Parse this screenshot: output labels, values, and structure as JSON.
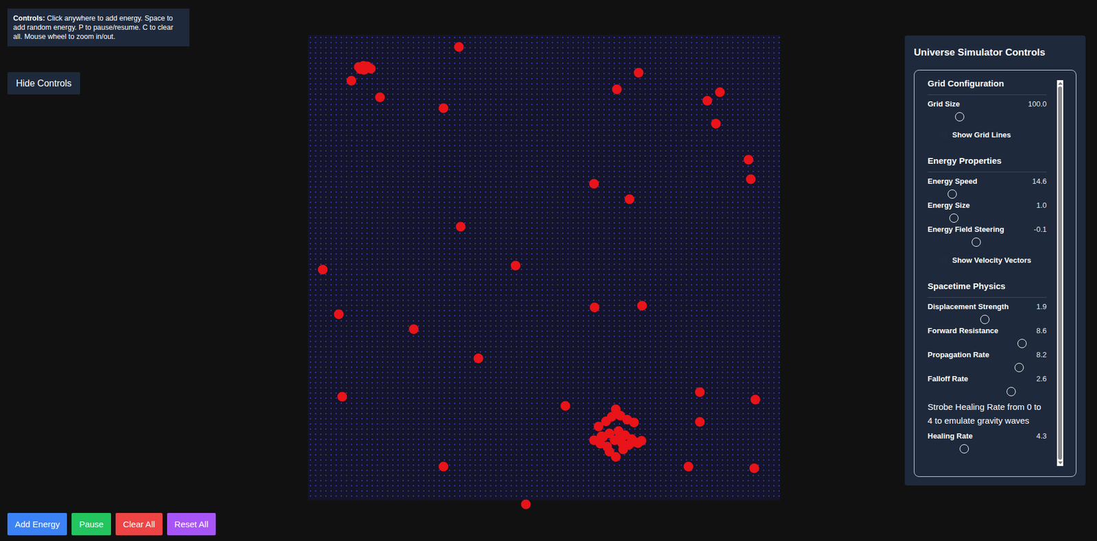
{
  "help": {
    "label": "Controls:",
    "text": " Click anywhere to add energy. Space to add random energy. P to pause/resume. C to clear all. Mouse wheel to zoom in/out."
  },
  "toggle_button": "Hide Controls",
  "panel": {
    "title": "Universe Simulator Controls",
    "sections": [
      {
        "title": "Grid Configuration",
        "items": [
          {
            "kind": "slider",
            "label": "Grid Size",
            "value": "100.0",
            "level": 0.25
          },
          {
            "kind": "checkbox",
            "label": "Show Grid Lines",
            "checked": false
          }
        ]
      },
      {
        "title": "Energy Properties",
        "items": [
          {
            "kind": "slider",
            "label": "Energy Speed",
            "value": "14.6",
            "level": 0.18
          },
          {
            "kind": "slider",
            "label": "Energy Size",
            "value": "1.0",
            "level": 0.2
          },
          {
            "kind": "slider",
            "label": "Energy Field Steering",
            "value": "-0.1",
            "level": 0.4
          },
          {
            "kind": "checkbox",
            "label": "Show Velocity Vectors",
            "checked": false
          }
        ]
      },
      {
        "title": "Spacetime Physics",
        "items": [
          {
            "kind": "slider",
            "label": "Displacement Strength",
            "value": "1.9",
            "level": 0.48
          },
          {
            "kind": "slider",
            "label": "Forward Resistance",
            "value": "8.6",
            "level": 0.82
          },
          {
            "kind": "slider",
            "label": "Propagation Rate",
            "value": "8.2",
            "level": 0.79
          },
          {
            "kind": "slider",
            "label": "Falloff Rate",
            "value": "2.6",
            "level": 0.72
          },
          {
            "kind": "note",
            "label": "Strobe Healing Rate from 0 to 4 to emulate gravity waves"
          },
          {
            "kind": "slider",
            "label": "Healing Rate",
            "value": "4.3",
            "level": 0.29
          }
        ]
      }
    ]
  },
  "buttons": [
    {
      "label": "Add Energy",
      "color": "#3b82f6"
    },
    {
      "label": "Pause",
      "color": "#22c55e"
    },
    {
      "label": "Clear All",
      "color": "#ef4444"
    },
    {
      "label": "Reset All",
      "color": "#a855f7"
    }
  ],
  "energy_particles": [
    {
      "x": 32.0,
      "y": 2.6
    },
    {
      "x": 10.8,
      "y": 6.9
    },
    {
      "x": 11.7,
      "y": 6.6
    },
    {
      "x": 12.6,
      "y": 6.8
    },
    {
      "x": 13.3,
      "y": 7.2
    },
    {
      "x": 11.9,
      "y": 7.5
    },
    {
      "x": 11.1,
      "y": 7.4
    },
    {
      "x": 9.2,
      "y": 9.8
    },
    {
      "x": 15.3,
      "y": 13.4
    },
    {
      "x": 28.7,
      "y": 15.8
    },
    {
      "x": 70.1,
      "y": 8.1
    },
    {
      "x": 65.5,
      "y": 11.7
    },
    {
      "x": 87.3,
      "y": 12.3
    },
    {
      "x": 84.6,
      "y": 14.1
    },
    {
      "x": 86.4,
      "y": 19.1
    },
    {
      "x": 93.3,
      "y": 26.8
    },
    {
      "x": 93.8,
      "y": 31.0
    },
    {
      "x": 60.6,
      "y": 32.0
    },
    {
      "x": 68.1,
      "y": 35.3
    },
    {
      "x": 32.4,
      "y": 41.2
    },
    {
      "x": 44.0,
      "y": 49.6
    },
    {
      "x": 3.1,
      "y": 50.4
    },
    {
      "x": 60.7,
      "y": 58.6
    },
    {
      "x": 70.8,
      "y": 58.2
    },
    {
      "x": 6.5,
      "y": 60.0
    },
    {
      "x": 22.4,
      "y": 63.2
    },
    {
      "x": 36.1,
      "y": 69.5
    },
    {
      "x": 83.0,
      "y": 76.7
    },
    {
      "x": 7.3,
      "y": 77.7
    },
    {
      "x": 94.8,
      "y": 78.3
    },
    {
      "x": 54.5,
      "y": 79.7
    },
    {
      "x": 83.0,
      "y": 83.2
    },
    {
      "x": 28.7,
      "y": 92.8
    },
    {
      "x": 80.6,
      "y": 92.8
    },
    {
      "x": 94.5,
      "y": 93.1
    },
    {
      "x": 46.2,
      "y": 100.9
    },
    {
      "x": 61.6,
      "y": 84.1
    },
    {
      "x": 63.1,
      "y": 83.0
    },
    {
      "x": 64.4,
      "y": 82.1
    },
    {
      "x": 65.2,
      "y": 80.5
    },
    {
      "x": 66.2,
      "y": 81.8
    },
    {
      "x": 67.6,
      "y": 82.6
    },
    {
      "x": 69.1,
      "y": 83.3
    },
    {
      "x": 62.5,
      "y": 86.3
    },
    {
      "x": 63.9,
      "y": 85.6
    },
    {
      "x": 65.8,
      "y": 85.1
    },
    {
      "x": 67.1,
      "y": 86.0
    },
    {
      "x": 68.6,
      "y": 86.8
    },
    {
      "x": 69.9,
      "y": 87.7
    },
    {
      "x": 70.7,
      "y": 87.2
    },
    {
      "x": 60.6,
      "y": 87.1
    },
    {
      "x": 61.9,
      "y": 87.8
    },
    {
      "x": 63.4,
      "y": 88.4
    },
    {
      "x": 65.0,
      "y": 87.1
    },
    {
      "x": 66.5,
      "y": 87.7
    },
    {
      "x": 68.0,
      "y": 88.1
    },
    {
      "x": 63.9,
      "y": 89.5
    },
    {
      "x": 65.2,
      "y": 90.7
    },
    {
      "x": 66.8,
      "y": 89.0
    },
    {
      "x": 69.2,
      "y": 87.5
    },
    {
      "x": 62.2,
      "y": 86.2
    },
    {
      "x": 66.1,
      "y": 86.2
    }
  ]
}
